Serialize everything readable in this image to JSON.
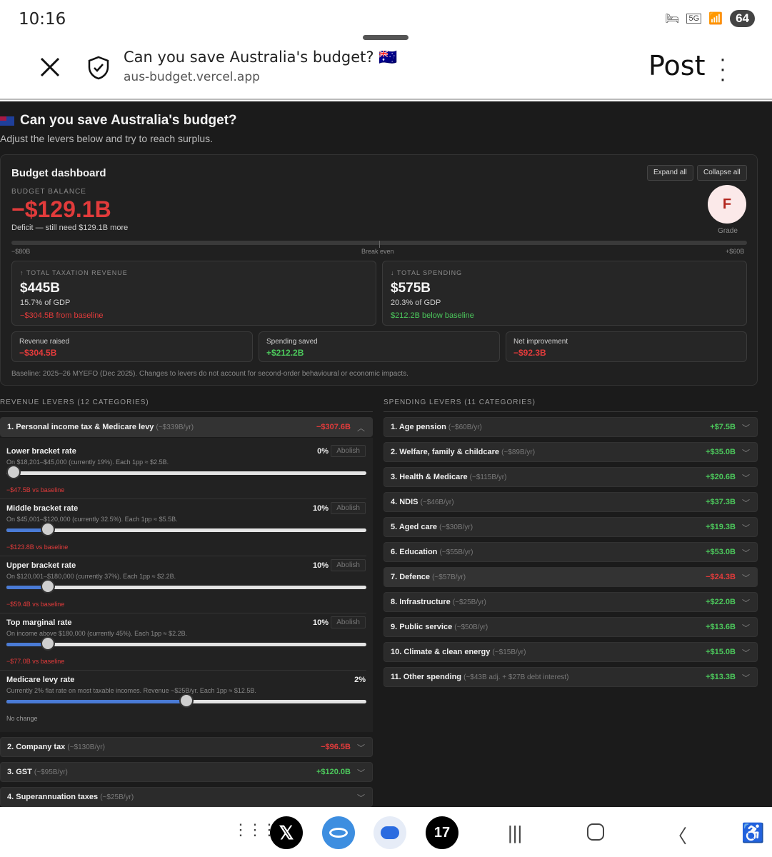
{
  "statusbar": {
    "time": "10:16",
    "network": "5G",
    "battery": "64"
  },
  "browser": {
    "page_title": "Can you save Australia's budget? 🇦🇺",
    "url": "aus-budget.vercel.app",
    "post_label": "Post"
  },
  "app": {
    "title": "Can you save Australia's budget?",
    "subtitle": "Adjust the levers below and try to reach surplus."
  },
  "dashboard": {
    "title": "Budget dashboard",
    "expand_all": "Expand all",
    "collapse_all": "Collapse all",
    "balance_label": "Budget balance",
    "balance_value": "−$129.1B",
    "deficit_note": "Deficit — still need $129.1B more",
    "grade": "F",
    "grade_label": "Grade",
    "scale_left": "−$80B",
    "scale_mid": "Break even",
    "scale_right": "+$60B",
    "revenue": {
      "label": "↑ Total taxation revenue",
      "value": "$445B",
      "gdp": "15.7% of GDP",
      "change": "−$304.5B from baseline"
    },
    "spending": {
      "label": "↓ Total spending",
      "value": "$575B",
      "gdp": "20.3% of GDP",
      "change": "$212.2B below baseline"
    },
    "revenue_raised": {
      "label": "Revenue raised",
      "value": "−$304.5B"
    },
    "spending_saved": {
      "label": "Spending saved",
      "value": "+$212.2B"
    },
    "net_improvement": {
      "label": "Net improvement",
      "value": "−$92.3B"
    },
    "baseline_note": "Baseline: 2025–26 MYEFO (Dec 2025). Changes to levers do not account for second-order behavioural or economic impacts."
  },
  "revenue_levers": {
    "heading": "Revenue levers (12 categories)",
    "items": [
      {
        "title": "1. Personal income tax & Medicare levy",
        "hint": "(~$339B/yr)",
        "delta": "−$307.6B"
      },
      {
        "title": "2. Company tax",
        "hint": "(~$130B/yr)",
        "delta": "−$96.5B"
      },
      {
        "title": "3. GST",
        "hint": "(~$95B/yr)",
        "delta": "+$120.0B"
      },
      {
        "title": "4. Superannuation taxes",
        "hint": "(~$25B/yr)",
        "delta": ""
      }
    ],
    "abolish_label": "Abolish",
    "sliders": [
      {
        "name": "Lower bracket rate",
        "value": "0%",
        "desc": "On $18,201–$45,000 (currently 19%). Each 1pp ≈ $2.5B.",
        "foot": "−$47.5B vs baseline",
        "level": 0
      },
      {
        "name": "Middle bracket rate",
        "value": "10%",
        "desc": "On $45,001–$120,000 (currently 32.5%). Each 1pp ≈ $5.5B.",
        "foot": "−$123.8B vs baseline",
        "level": 0.115
      },
      {
        "name": "Upper bracket rate",
        "value": "10%",
        "desc": "On $120,001–$180,000 (currently 37%). Each 1pp ≈ $2.2B.",
        "foot": "−$59.4B vs baseline",
        "level": 0.115
      },
      {
        "name": "Top marginal rate",
        "value": "10%",
        "desc": "On income above $180,000 (currently 45%). Each 1pp ≈ $2.2B.",
        "foot": "−$77.0B vs baseline",
        "level": 0.115
      },
      {
        "name": "Medicare levy rate",
        "value": "2%",
        "desc": "Currently 2% flat rate on most taxable incomes. Revenue ~$25B/yr. Each 1pp ≈ $12.5B.",
        "foot": "No change",
        "level": 0.5
      }
    ]
  },
  "spending_levers": {
    "heading": "Spending levers (11 categories)",
    "items": [
      {
        "title": "1. Age pension",
        "hint": "(~$60B/yr)",
        "delta": "+$7.5B"
      },
      {
        "title": "2. Welfare, family & childcare",
        "hint": "(~$89B/yr)",
        "delta": "+$35.0B"
      },
      {
        "title": "3. Health & Medicare",
        "hint": "(~$115B/yr)",
        "delta": "+$20.6B"
      },
      {
        "title": "4. NDIS",
        "hint": "(~$46B/yr)",
        "delta": "+$37.3B"
      },
      {
        "title": "5. Aged care",
        "hint": "(~$30B/yr)",
        "delta": "+$19.3B"
      },
      {
        "title": "6. Education",
        "hint": "(~$55B/yr)",
        "delta": "+$53.0B"
      },
      {
        "title": "7. Defence",
        "hint": "(~$57B/yr)",
        "delta": "−$24.3B"
      },
      {
        "title": "8. Infrastructure",
        "hint": "(~$25B/yr)",
        "delta": "+$22.0B"
      },
      {
        "title": "9. Public service",
        "hint": "(~$50B/yr)",
        "delta": "+$13.6B"
      },
      {
        "title": "10. Climate & clean energy",
        "hint": "(~$15B/yr)",
        "delta": "+$15.0B"
      },
      {
        "title": "11. Other spending",
        "hint": "(~$43B adj. + $27B debt interest)",
        "delta": "+$13.3B"
      }
    ]
  },
  "colors": {
    "negative": "#e23b3b",
    "positive": "#4cc95c",
    "accent": "#4a7bd6",
    "background": "#1b1b1b"
  },
  "icons": [
    "close-icon",
    "shield-icon",
    "more-icon",
    "chevron-up-icon",
    "chevron-down-icon",
    "apps-grid-icon",
    "recents-icon",
    "home-icon",
    "back-icon",
    "accessibility-icon"
  ]
}
